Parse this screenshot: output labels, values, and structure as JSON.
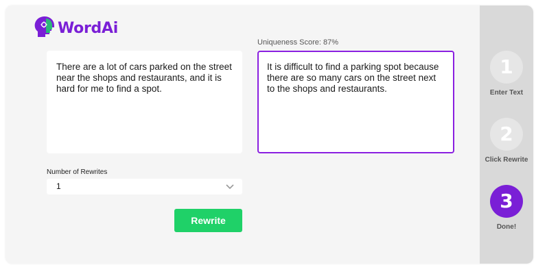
{
  "brand": {
    "name": "WordAi",
    "color_purple": "#7a1fd6",
    "color_green": "#1fd168"
  },
  "editor": {
    "input_text": "There are a lot of cars parked on the street near the shops and restaurants, and it is hard for me to find a spot.",
    "output_text": "It is difficult to find a parking spot because there are so many cars on the street next to the shops and restaurants.",
    "uniqueness_score": "Uniqueness Score: 87%"
  },
  "options": {
    "rewrites_label": "Number of Rewrites",
    "rewrites_value": "1"
  },
  "actions": {
    "rewrite_label": "Rewrite"
  },
  "steps": [
    {
      "number": "1",
      "label": "Enter Text",
      "active": false
    },
    {
      "number": "2",
      "label": "Click Rewrite",
      "active": false
    },
    {
      "number": "3",
      "label": "Done!",
      "active": true
    }
  ]
}
